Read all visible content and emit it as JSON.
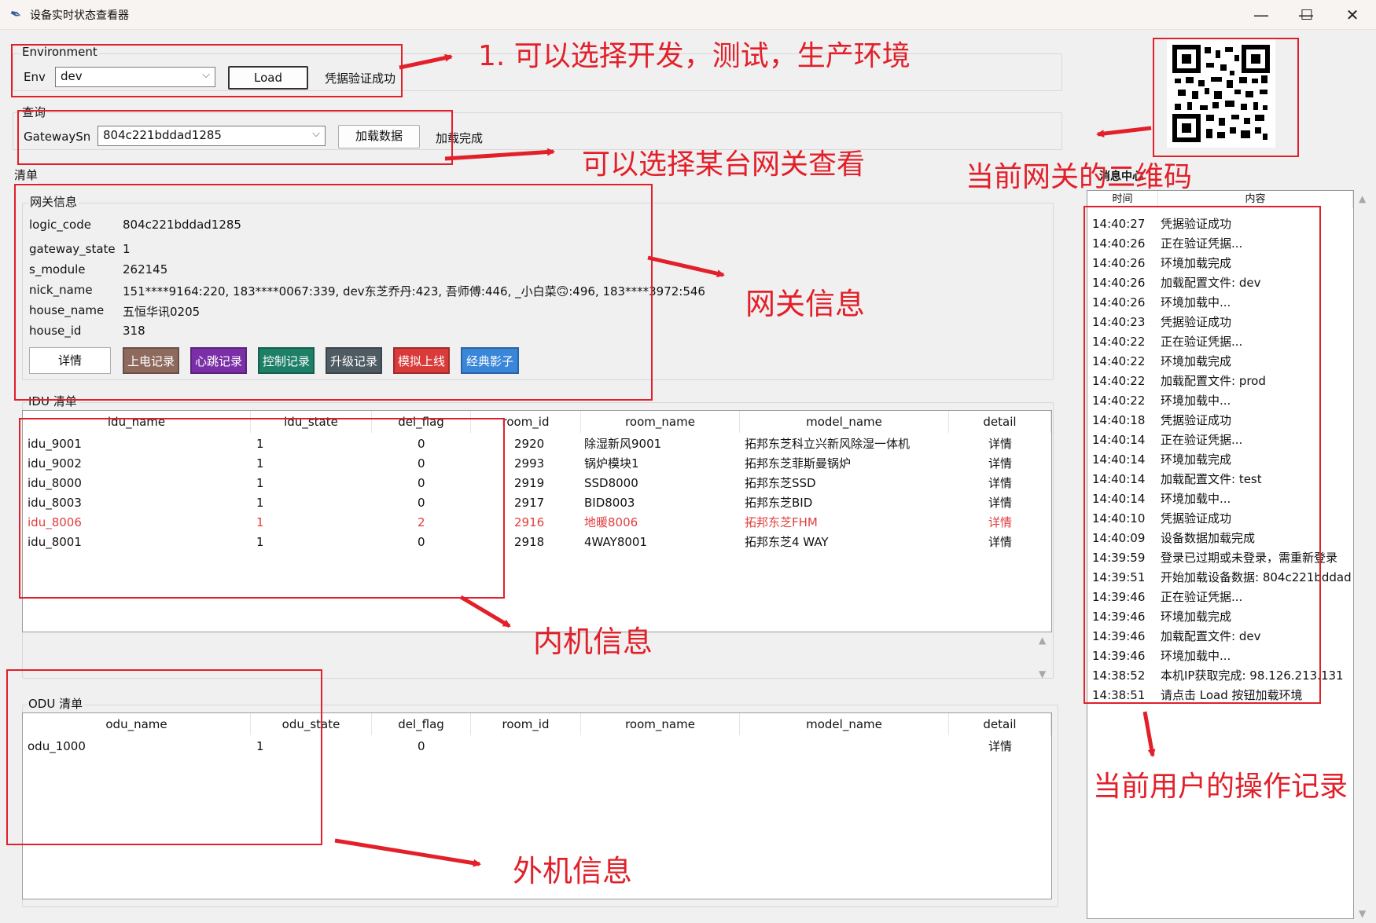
{
  "window": {
    "title": "设备实时状态查看器",
    "minimize_glyph": "—",
    "maximize_glyph": "☐",
    "close_glyph": "✕"
  },
  "environment": {
    "group_label": "Environment",
    "env_label": "Env",
    "env_value": "dev",
    "load_button": "Load",
    "status_text": "凭据验证成功"
  },
  "query": {
    "group_label": "查询",
    "gateway_label": "GatewaySn",
    "gateway_value": "804c221bddad1285",
    "load_data_button": "加载数据",
    "status_text": "加载完成"
  },
  "list_section_label": "清单",
  "gateway_info": {
    "group_label": "网关信息",
    "fields": [
      {
        "label": "logic_code",
        "value": "804c221bddad1285"
      },
      {
        "label": "gateway_state",
        "value": "1"
      },
      {
        "label": "s_module",
        "value": "262145"
      },
      {
        "label": "nick_name",
        "value": "151****9164:220, 183****0067:339, dev东芝乔丹:423, 吾师傅:446, _小白菜🙃:496, 183****3972:546"
      },
      {
        "label": "house_name",
        "value": "五恒华讯0205"
      },
      {
        "label": "house_id",
        "value": "318"
      }
    ],
    "buttons": [
      {
        "label": "详情",
        "color": "#ffffff",
        "text_color": "#111111"
      },
      {
        "label": "上电记录",
        "color": "#8e6a5e",
        "text_color": "#ffffff"
      },
      {
        "label": "心跳记录",
        "color": "#7a2fa6",
        "text_color": "#ffffff"
      },
      {
        "label": "控制记录",
        "color": "#1d7f66",
        "text_color": "#ffffff"
      },
      {
        "label": "升级记录",
        "color": "#4e5b62",
        "text_color": "#ffffff"
      },
      {
        "label": "模拟上线",
        "color": "#d93a3a",
        "text_color": "#ffffff"
      },
      {
        "label": "经典影子",
        "color": "#3a86d9",
        "text_color": "#ffffff"
      }
    ]
  },
  "idu": {
    "group_label": "IDU 清单",
    "columns": [
      "idu_name",
      "idu_state",
      "del_flag",
      "room_id",
      "room_name",
      "model_name",
      "detail"
    ],
    "rows": [
      {
        "cells": [
          "idu_9001",
          "1",
          "0",
          "2920",
          "除湿新风9001",
          "拓邦东芝科立兴新风除湿一体机",
          "详情"
        ],
        "highlight": false
      },
      {
        "cells": [
          "idu_9002",
          "1",
          "0",
          "2993",
          "锅炉模块1",
          "拓邦东芝菲斯曼锅炉",
          "详情"
        ],
        "highlight": false
      },
      {
        "cells": [
          "idu_8000",
          "1",
          "0",
          "2919",
          "SSD8000",
          "拓邦东芝SSD",
          "详情"
        ],
        "highlight": false
      },
      {
        "cells": [
          "idu_8003",
          "1",
          "0",
          "2917",
          "BID8003",
          "拓邦东芝BID",
          "详情"
        ],
        "highlight": false
      },
      {
        "cells": [
          "idu_8006",
          "1",
          "2",
          "2916",
          "地暖8006",
          "拓邦东芝FHM",
          "详情"
        ],
        "highlight": true
      },
      {
        "cells": [
          "idu_8001",
          "1",
          "0",
          "2918",
          "4WAY8001",
          "拓邦东芝4 WAY",
          "详情"
        ],
        "highlight": false
      }
    ],
    "highlight_color": "#e23d3d"
  },
  "odu": {
    "group_label": "ODU 清单",
    "columns": [
      "odu_name",
      "odu_state",
      "del_flag",
      "room_id",
      "room_name",
      "model_name",
      "detail"
    ],
    "rows": [
      {
        "cells": [
          "odu_1000",
          "1",
          "0",
          "",
          "",
          "",
          "详情"
        ]
      }
    ]
  },
  "message_center": {
    "title": "消息中心",
    "columns": [
      "时间",
      "内容"
    ],
    "messages": [
      {
        "time": "14:40:27",
        "text": "凭据验证成功"
      },
      {
        "time": "14:40:26",
        "text": "正在验证凭据..."
      },
      {
        "time": "14:40:26",
        "text": "环境加载完成"
      },
      {
        "time": "14:40:26",
        "text": "加载配置文件: dev"
      },
      {
        "time": "14:40:26",
        "text": "环境加载中..."
      },
      {
        "time": "14:40:23",
        "text": "凭据验证成功"
      },
      {
        "time": "14:40:22",
        "text": "正在验证凭据..."
      },
      {
        "time": "14:40:22",
        "text": "环境加载完成"
      },
      {
        "time": "14:40:22",
        "text": "加载配置文件: prod"
      },
      {
        "time": "14:40:22",
        "text": "环境加载中..."
      },
      {
        "time": "14:40:18",
        "text": "凭据验证成功"
      },
      {
        "time": "14:40:14",
        "text": "正在验证凭据..."
      },
      {
        "time": "14:40:14",
        "text": "环境加载完成"
      },
      {
        "time": "14:40:14",
        "text": "加载配置文件: test"
      },
      {
        "time": "14:40:14",
        "text": "环境加载中..."
      },
      {
        "time": "14:40:10",
        "text": "凭据验证成功"
      },
      {
        "time": "14:40:09",
        "text": "设备数据加载完成"
      },
      {
        "time": "14:39:59",
        "text": "登录已过期或未登录，需重新登录"
      },
      {
        "time": "14:39:51",
        "text": "开始加载设备数据: 804c221bddad"
      },
      {
        "time": "14:39:46",
        "text": "正在验证凭据..."
      },
      {
        "time": "14:39:46",
        "text": "环境加载完成"
      },
      {
        "time": "14:39:46",
        "text": "加载配置文件: dev"
      },
      {
        "time": "14:39:46",
        "text": "环境加载中..."
      },
      {
        "time": "14:38:52",
        "text": "本机IP获取完成: 98.126.213.131"
      },
      {
        "time": "14:38:51",
        "text": "请点击 Load 按钮加载环境"
      }
    ]
  },
  "annotations": {
    "env_note": "1. 可以选择开发，测试，生产环境",
    "gateway_note": "可以选择某台网关查看",
    "qr_note": "当前网关的二维码",
    "gateway_info_note": "网关信息",
    "idu_note": "内机信息",
    "odu_note": "外机信息",
    "log_note": "当前用户的操作记录",
    "color": "#e2202a"
  }
}
